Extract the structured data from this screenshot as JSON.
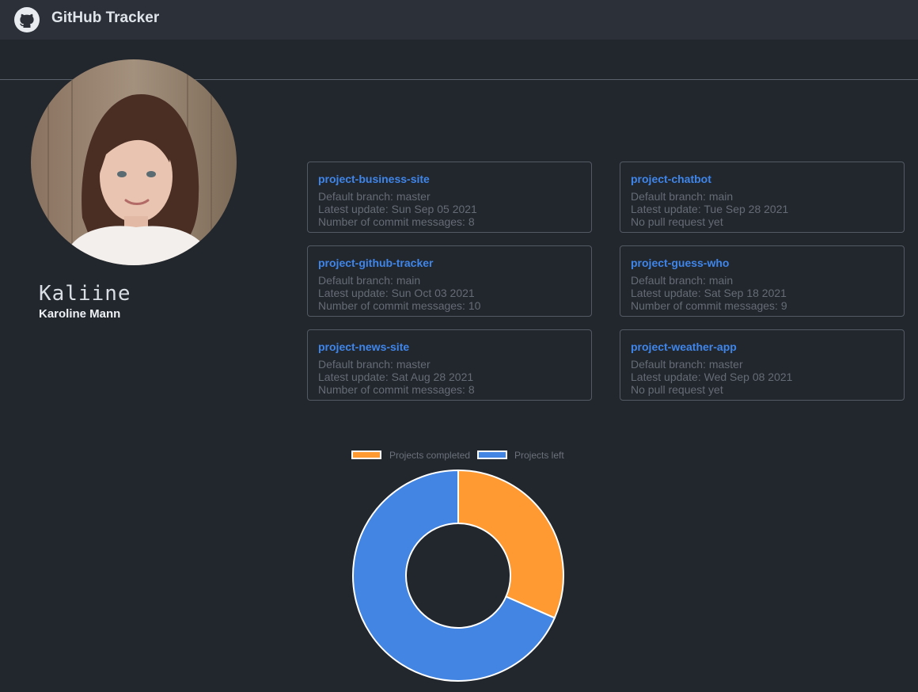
{
  "header": {
    "app_title": "GitHub Tracker"
  },
  "profile": {
    "username": "Kaliine",
    "full_name": "Karoline Mann"
  },
  "projects": [
    {
      "name": "project-business-site",
      "branch": "Default branch: master",
      "updated": "Latest update: Sun Sep 05 2021",
      "commits": "Number of commit messages: 8"
    },
    {
      "name": "project-chatbot",
      "branch": "Default branch: main",
      "updated": "Latest update: Tue Sep 28 2021",
      "commits": "No pull request yet"
    },
    {
      "name": "project-github-tracker",
      "branch": "Default branch: main",
      "updated": "Latest update: Sun Oct 03 2021",
      "commits": "Number of commit messages: 10"
    },
    {
      "name": "project-guess-who",
      "branch": "Default branch: main",
      "updated": "Latest update: Sat Sep 18 2021",
      "commits": "Number of commit messages: 9"
    },
    {
      "name": "project-news-site",
      "branch": "Default branch: master",
      "updated": "Latest update: Sat Aug 28 2021",
      "commits": "Number of commit messages: 8"
    },
    {
      "name": "project-weather-app",
      "branch": "Default branch: master",
      "updated": "Latest update: Wed Sep 08 2021",
      "commits": "No pull request yet"
    }
  ],
  "chart_data": {
    "type": "pie",
    "variant": "doughnut",
    "categories": [
      "Projects completed",
      "Projects left"
    ],
    "values": [
      6,
      13
    ],
    "colors": [
      "#ff9a33",
      "#4285e3"
    ],
    "legend": "top"
  }
}
